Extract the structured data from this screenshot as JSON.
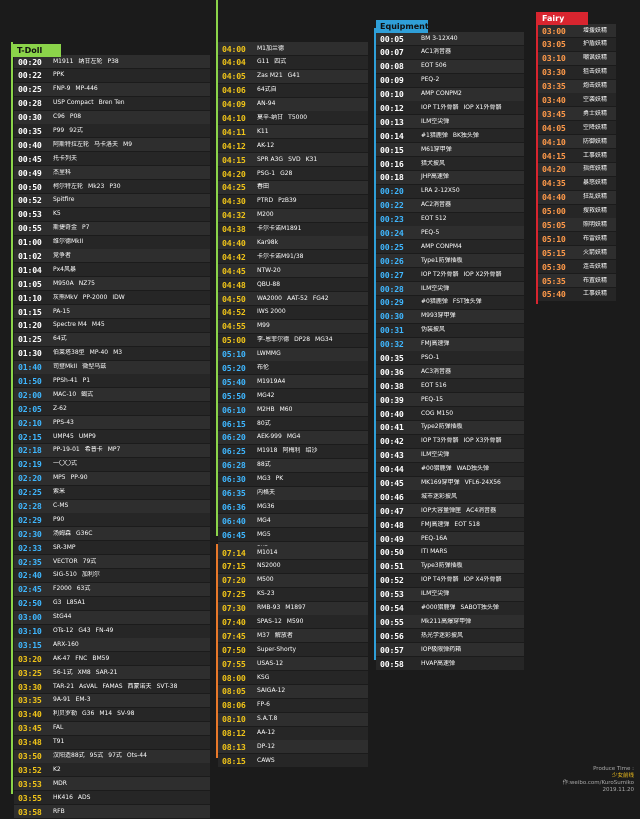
{
  "colors": {
    "tdoll": "#8bd44a",
    "equip": "#2f9fd8",
    "fairy": "#d8252f",
    "time_tdoll": "#ffffff",
    "time_blue": "#3fb7ff",
    "time_orange": "#ff9a4a",
    "time_yellow": "#f0c419"
  },
  "tdoll": {
    "header": "T-Doll",
    "rows": [
      {
        "time": "00:20",
        "items": [
          "M1911",
          "纳甘左轮",
          "P38"
        ]
      },
      {
        "time": "00:22",
        "items": [
          "PPK"
        ]
      },
      {
        "time": "00:25",
        "items": [
          "FNP-9",
          "MP-446"
        ]
      },
      {
        "time": "00:28",
        "items": [
          "USP Compact",
          "Bren Ten"
        ]
      },
      {
        "time": "00:30",
        "items": [
          "C96",
          "P08"
        ]
      },
      {
        "time": "00:35",
        "items": [
          "P99",
          "92式"
        ]
      },
      {
        "time": "00:40",
        "items": [
          "阿斯特拉左轮",
          "马卡洛夫",
          "M9"
        ]
      },
      {
        "time": "00:45",
        "items": [
          "托卡列夫"
        ]
      },
      {
        "time": "00:49",
        "items": [
          "杰里科"
        ]
      },
      {
        "time": "00:50",
        "items": [
          "柯尔特左轮",
          "Mk23",
          "P30"
        ]
      },
      {
        "time": "00:52",
        "items": [
          "Spitfire"
        ]
      },
      {
        "time": "00:53",
        "items": [
          "K5"
        ]
      },
      {
        "time": "00:55",
        "items": [
          "斯捷奇金",
          "P7"
        ]
      },
      {
        "time": "01:00",
        "items": [
          "维尔德MkII"
        ]
      },
      {
        "time": "01:02",
        "items": [
          "竞争者"
        ]
      },
      {
        "time": "01:04",
        "items": [
          "Px4风暴"
        ]
      },
      {
        "time": "01:05",
        "items": [
          "M950A",
          "NZ75"
        ]
      },
      {
        "time": "01:10",
        "items": [
          "灰熊MkV",
          "PP-2000",
          "IDW"
        ]
      },
      {
        "time": "01:15",
        "items": [
          "PA-15"
        ]
      },
      {
        "time": "01:20",
        "items": [
          "Spectre M4",
          "M45"
        ]
      },
      {
        "time": "01:25",
        "items": [
          "64式"
        ]
      },
      {
        "time": "01:30",
        "items": [
          "伯莱塔38型",
          "MP-40",
          "M3"
        ]
      },
      {
        "time": "01:40",
        "items": [
          "司登MkII",
          "微型乌兹"
        ]
      },
      {
        "time": "01:50",
        "items": [
          "PPSh-41",
          "P1"
        ]
      },
      {
        "time": "02:00",
        "items": [
          "MAC-10",
          "蝎式"
        ]
      },
      {
        "time": "02:05",
        "items": [
          "Z-62"
        ]
      },
      {
        "time": "02:10",
        "items": [
          "PPS-43"
        ]
      },
      {
        "time": "02:15",
        "items": [
          "UMP45",
          "UMP9"
        ]
      },
      {
        "time": "02:18",
        "items": [
          "PP-19-01",
          "希普卡",
          "MP7"
        ]
      },
      {
        "time": "02:19",
        "items": [
          "一〇〇式"
        ]
      },
      {
        "time": "02:20",
        "items": [
          "MP5",
          "PP-90"
        ]
      },
      {
        "time": "02:25",
        "items": [
          "索米"
        ]
      },
      {
        "time": "02:28",
        "items": [
          "C-MS"
        ]
      },
      {
        "time": "02:29",
        "items": [
          "P90"
        ]
      },
      {
        "time": "02:30",
        "items": [
          "汤姆森",
          "G36C"
        ]
      },
      {
        "time": "02:33",
        "items": [
          "SR-3MP"
        ]
      },
      {
        "time": "02:35",
        "items": [
          "VECTOR",
          "79式"
        ]
      },
      {
        "time": "02:40",
        "items": [
          "SIG-510",
          "加利尔"
        ]
      },
      {
        "time": "02:45",
        "items": [
          "F2000",
          "63式"
        ]
      },
      {
        "time": "02:50",
        "items": [
          "G3",
          "L85A1"
        ]
      },
      {
        "time": "03:00",
        "items": [
          "StG44"
        ]
      },
      {
        "time": "03:10",
        "items": [
          "OTs-12",
          "G43",
          "FN-49"
        ]
      },
      {
        "time": "03:15",
        "items": [
          "ARX-160"
        ]
      },
      {
        "time": "03:20",
        "items": [
          "AK-47",
          "FNC",
          "BM59"
        ]
      },
      {
        "time": "03:25",
        "items": [
          "56-1式",
          "XM8",
          "SAR-21"
        ]
      },
      {
        "time": "03:30",
        "items": [
          "TAR-21",
          "AsVAL",
          "FAMAS",
          "西蒙诺夫",
          "SVT-38"
        ]
      },
      {
        "time": "03:35",
        "items": [
          "9A-91",
          "EM-3"
        ]
      },
      {
        "time": "03:40",
        "items": [
          "利贝罗勒",
          "G36",
          "M14",
          "SV-98"
        ]
      },
      {
        "time": "03:45",
        "items": [
          "FAL"
        ]
      },
      {
        "time": "03:48",
        "items": [
          "T91"
        ]
      },
      {
        "time": "03:50",
        "items": [
          "汉阳造88式",
          "95式",
          "97式",
          "Ots-44"
        ]
      },
      {
        "time": "03:52",
        "items": [
          "K2"
        ]
      },
      {
        "time": "03:53",
        "items": [
          "MDR"
        ]
      },
      {
        "time": "03:55",
        "items": [
          "HK416",
          "ADS"
        ]
      },
      {
        "time": "03:58",
        "items": [
          "RFB"
        ]
      }
    ],
    "rows2": [
      {
        "time": "04:00",
        "items": [
          "M1加兰德"
        ]
      },
      {
        "time": "04:04",
        "items": [
          "G11",
          "四式"
        ]
      },
      {
        "time": "04:05",
        "items": [
          "Zas M21",
          "G41"
        ]
      },
      {
        "time": "04:06",
        "items": [
          "64式自"
        ]
      },
      {
        "time": "04:09",
        "items": [
          "AN-94"
        ]
      },
      {
        "time": "04:10",
        "items": [
          "莫辛-纳甘",
          "T5000"
        ]
      },
      {
        "time": "04:11",
        "items": [
          "K11"
        ]
      },
      {
        "time": "04:12",
        "items": [
          "AK-12"
        ]
      },
      {
        "time": "04:15",
        "items": [
          "SPR A3G",
          "SVD",
          "K31"
        ]
      },
      {
        "time": "04:20",
        "items": [
          "PSG-1",
          "G28"
        ]
      },
      {
        "time": "04:25",
        "items": [
          "春田"
        ]
      },
      {
        "time": "04:30",
        "items": [
          "PTRD",
          "PzB39"
        ]
      },
      {
        "time": "04:32",
        "items": [
          "M200"
        ]
      },
      {
        "time": "04:38",
        "items": [
          "卡尔卡诺M1891"
        ]
      },
      {
        "time": "04:40",
        "items": [
          "Kar98k"
        ]
      },
      {
        "time": "04:42",
        "items": [
          "卡尔卡诺M91/38"
        ]
      },
      {
        "time": "04:45",
        "items": [
          "NTW-20"
        ]
      },
      {
        "time": "04:48",
        "items": [
          "QBU-88"
        ]
      },
      {
        "time": "04:50",
        "items": [
          "WA2000",
          "AAT-52",
          "FG42"
        ]
      },
      {
        "time": "04:52",
        "items": [
          "IWS 2000"
        ]
      },
      {
        "time": "04:55",
        "items": [
          "M99"
        ]
      },
      {
        "time": "05:00",
        "items": [
          "李-恩菲尔德",
          "DP28",
          "MG34"
        ]
      },
      {
        "time": "05:10",
        "items": [
          "LWMMG"
        ]
      },
      {
        "time": "05:20",
        "items": [
          "布伦"
        ]
      },
      {
        "time": "05:40",
        "items": [
          "M1919A4"
        ]
      },
      {
        "time": "05:50",
        "items": [
          "MG42"
        ]
      },
      {
        "time": "06:10",
        "items": [
          "M2HB",
          "M60"
        ]
      },
      {
        "time": "06:15",
        "items": [
          "80式"
        ]
      },
      {
        "time": "06:20",
        "items": [
          "AEK-999",
          "MG4"
        ]
      },
      {
        "time": "06:25",
        "items": [
          "M1918",
          "阿梅利",
          "绍沙"
        ]
      },
      {
        "time": "06:28",
        "items": [
          "88式"
        ]
      },
      {
        "time": "06:30",
        "items": [
          "MG3",
          "PK"
        ]
      },
      {
        "time": "06:35",
        "items": [
          "内格夫"
        ]
      },
      {
        "time": "06:36",
        "items": [
          "MG36"
        ]
      },
      {
        "time": "06:40",
        "items": [
          "MG4"
        ]
      },
      {
        "time": "06:45",
        "items": [
          "MG5"
        ]
      },
      {
        "time": "06:50",
        "items": [
          "PKP"
        ]
      }
    ],
    "rows3": [
      {
        "time": "07:14",
        "items": [
          "M1014"
        ]
      },
      {
        "time": "07:15",
        "items": [
          "NS2000"
        ]
      },
      {
        "time": "07:20",
        "items": [
          "M500"
        ]
      },
      {
        "time": "07:25",
        "items": [
          "KS-23"
        ]
      },
      {
        "time": "07:30",
        "items": [
          "RMB-93",
          "M1897"
        ]
      },
      {
        "time": "07:40",
        "items": [
          "SPAS-12",
          "M590"
        ]
      },
      {
        "time": "07:45",
        "items": [
          "M37",
          "解放者"
        ]
      },
      {
        "time": "07:50",
        "items": [
          "Super-Shorty"
        ]
      },
      {
        "time": "07:55",
        "items": [
          "USAS-12"
        ]
      },
      {
        "time": "08:00",
        "items": [
          "KSG"
        ]
      },
      {
        "time": "08:05",
        "items": [
          "SAIGA-12"
        ]
      },
      {
        "time": "08:06",
        "items": [
          "FP-6"
        ]
      },
      {
        "time": "08:10",
        "items": [
          "S.A.T.8"
        ]
      },
      {
        "time": "08:12",
        "items": [
          "AA-12"
        ]
      },
      {
        "time": "08:13",
        "items": [
          "DP-12"
        ]
      },
      {
        "time": "08:15",
        "items": [
          "CAWS"
        ]
      }
    ]
  },
  "equip": {
    "header": "Equipment",
    "rows": [
      {
        "time": "00:05",
        "items": [
          "BM 3-12X40"
        ]
      },
      {
        "time": "00:07",
        "items": [
          "AC1消音器"
        ]
      },
      {
        "time": "00:08",
        "items": [
          "EOT 506"
        ]
      },
      {
        "time": "00:09",
        "items": [
          "PEQ-2"
        ]
      },
      {
        "time": "00:10",
        "items": [
          "AMP CONPM2"
        ]
      },
      {
        "time": "00:12",
        "items": [
          "IOP T1外骨骼",
          "IOP X1外骨骼"
        ]
      },
      {
        "time": "00:13",
        "items": [
          "ILM空尖弹"
        ]
      },
      {
        "time": "00:14",
        "items": [
          "#1猎鹿弹",
          "BK独头弹"
        ]
      },
      {
        "time": "00:15",
        "items": [
          "M61穿甲弹"
        ]
      },
      {
        "time": "00:16",
        "items": [
          "猎犬披风"
        ]
      },
      {
        "time": "00:18",
        "items": [
          "JHP高速弹"
        ]
      },
      {
        "time": "00:20",
        "items": [
          "LRA 2-12X50"
        ]
      },
      {
        "time": "00:22",
        "items": [
          "AC2消音器"
        ]
      },
      {
        "time": "00:23",
        "items": [
          "EOT 512"
        ]
      },
      {
        "time": "00:24",
        "items": [
          "PEQ-5"
        ]
      },
      {
        "time": "00:25",
        "items": [
          "AMP CONPM4"
        ]
      },
      {
        "time": "00:26",
        "items": [
          "Type1防弹插板"
        ]
      },
      {
        "time": "00:27",
        "items": [
          "IOP T2外骨骼",
          "IOP X2外骨骼"
        ]
      },
      {
        "time": "00:28",
        "items": [
          "ILM空尖弹"
        ]
      },
      {
        "time": "00:29",
        "items": [
          "#0猎鹿弹",
          "FST独头弹"
        ]
      },
      {
        "time": "00:30",
        "items": [
          "M993穿甲弹"
        ]
      },
      {
        "time": "00:31",
        "items": [
          "伪装披风"
        ]
      },
      {
        "time": "00:32",
        "items": [
          "FMJ高速弹"
        ]
      },
      {
        "time": "00:35",
        "items": [
          "PSO-1"
        ]
      },
      {
        "time": "00:36",
        "items": [
          "AC3消音器"
        ]
      },
      {
        "time": "00:38",
        "items": [
          "EOT 516"
        ]
      },
      {
        "time": "00:39",
        "items": [
          "PEQ-15"
        ]
      },
      {
        "time": "00:40",
        "items": [
          "COG M150"
        ]
      },
      {
        "time": "00:41",
        "items": [
          "Type2防弹插板"
        ]
      },
      {
        "time": "00:42",
        "items": [
          "IOP T3外骨骼",
          "IOP X3外骨骼"
        ]
      },
      {
        "time": "00:43",
        "items": [
          "ILM空尖弹"
        ]
      },
      {
        "time": "00:44",
        "items": [
          "#00猎鹿弹",
          "WAD独头弹"
        ]
      },
      {
        "time": "00:45",
        "items": [
          "MK169穿甲弹",
          "VFL6-24X56"
        ]
      },
      {
        "time": "00:46",
        "items": [
          "城市迷彩披风"
        ]
      },
      {
        "time": "00:47",
        "items": [
          "IOP大容量弹匣",
          "AC4消音器"
        ]
      },
      {
        "time": "00:48",
        "items": [
          "FMJ高速弹",
          "EOT 518"
        ]
      },
      {
        "time": "00:49",
        "items": [
          "PEQ-16A"
        ]
      },
      {
        "time": "00:50",
        "items": [
          "ITI MARS"
        ]
      },
      {
        "time": "00:51",
        "items": [
          "Type3防弹插板"
        ]
      },
      {
        "time": "00:52",
        "items": [
          "IOP T4外骨骼",
          "IOP X4外骨骼"
        ]
      },
      {
        "time": "00:53",
        "items": [
          "ILM空尖弹"
        ]
      },
      {
        "time": "00:54",
        "items": [
          "#000猎鹿弹",
          "SABOT独头弹"
        ]
      },
      {
        "time": "00:55",
        "items": [
          "Mk211高爆穿甲弹"
        ]
      },
      {
        "time": "00:56",
        "items": [
          "热光学迷彩披风"
        ]
      },
      {
        "time": "00:57",
        "items": [
          "IOP极限弹药箱"
        ]
      },
      {
        "time": "00:58",
        "items": [
          "HVAP高速弹"
        ]
      }
    ]
  },
  "fairy": {
    "header": "Fairy",
    "rows": [
      {
        "time": "03:00",
        "items": [
          "增援妖精"
        ]
      },
      {
        "time": "03:05",
        "items": [
          "护盾妖精"
        ]
      },
      {
        "time": "03:10",
        "items": [
          "嘲讽妖精"
        ]
      },
      {
        "time": "03:30",
        "items": [
          "狙击妖精"
        ]
      },
      {
        "time": "03:35",
        "items": [
          "炮击妖精"
        ]
      },
      {
        "time": "03:40",
        "items": [
          "空袭妖精"
        ]
      },
      {
        "time": "03:45",
        "items": [
          "勇士妖精"
        ]
      },
      {
        "time": "04:05",
        "items": [
          "空降妖精"
        ]
      },
      {
        "time": "04:10",
        "items": [
          "防御妖精"
        ]
      },
      {
        "time": "04:15",
        "items": [
          "工事妖精"
        ]
      },
      {
        "time": "04:20",
        "items": [
          "指挥妖精"
        ]
      },
      {
        "time": "04:35",
        "items": [
          "暴怒妖精"
        ]
      },
      {
        "time": "04:40",
        "items": [
          "狂乱妖精"
        ]
      },
      {
        "time": "05:00",
        "items": [
          "搜救妖精"
        ]
      },
      {
        "time": "05:05",
        "items": [
          "照明妖精"
        ]
      },
      {
        "time": "05:10",
        "items": [
          "布雷妖精"
        ]
      },
      {
        "time": "05:15",
        "items": [
          "火箭妖精"
        ]
      },
      {
        "time": "05:30",
        "items": [
          "连击妖精"
        ]
      },
      {
        "time": "05:35",
        "items": [
          "布置妖精"
        ]
      },
      {
        "time": "05:40",
        "items": [
          "工事妖精"
        ]
      }
    ]
  },
  "footer": {
    "line1": "Produce Time :",
    "line2": "少女前线",
    "line3": "作:weibo.com/KuroSumiko",
    "line4": "2019.11.20"
  }
}
